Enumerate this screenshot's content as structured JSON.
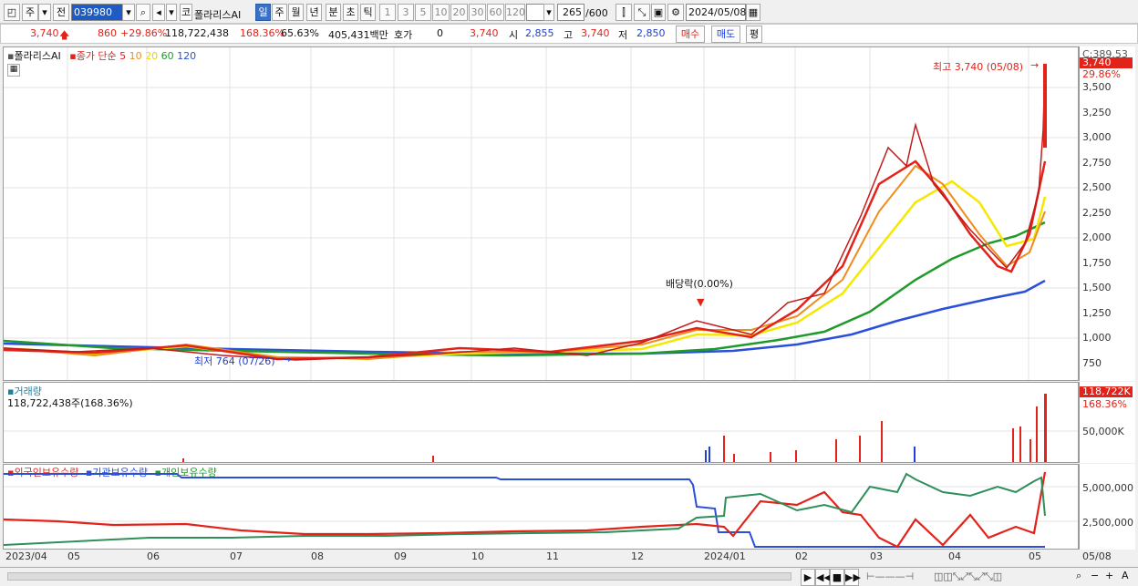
{
  "toolbar": {
    "period": "주",
    "prev": "전",
    "code": "039980",
    "market": "코",
    "name": "폴라리스AI",
    "tabs": [
      "일",
      "주",
      "월",
      "년",
      "분",
      "초",
      "틱"
    ],
    "active_tab": "일",
    "intervals": [
      "1",
      "3",
      "5",
      "10",
      "20",
      "30",
      "60",
      "120"
    ],
    "count": "265",
    "count_max": "/600",
    "date": "2024/05/08"
  },
  "quote": {
    "price": "3,740",
    "change": "860",
    "change_pct": "+29.86%",
    "volume": "118,722,438",
    "vol_ratio": "168.36%",
    "turnover_pct": "65.63%",
    "amount": "405,431백만",
    "hoga_label": "호가",
    "hoga_val": "0",
    "hoga_price": "3,740",
    "open_label": "시",
    "open": "2,855",
    "high_label": "고",
    "high": "3,740",
    "low_label": "저",
    "low": "2,850",
    "buy": "매수",
    "sell": "매도",
    "avg": "평"
  },
  "price_panel": {
    "legend_name": "폴라리스AI",
    "legend_ma": "종가 단순 5",
    "legend_ma_others": [
      "10",
      "20",
      "60",
      "120"
    ],
    "high_note": "최고 3,740 (05/08)",
    "low_note": "최저 764 (07/26)",
    "dividend": "배당락(0.00%)",
    "axis_top": "C:389.53",
    "last_price_tag": "3,740",
    "last_pct": "29.86%",
    "yticks": [
      "3,500",
      "3,250",
      "3,000",
      "2,750",
      "2,500",
      "2,250",
      "2,000",
      "1,750",
      "1,500",
      "1,250",
      "1,000",
      "750"
    ]
  },
  "volume_panel": {
    "title": "거래량",
    "subtitle": "118,722,438주(168.36%)",
    "tag": "118,722K",
    "pct": "168.36%",
    "ytick": "50,000K"
  },
  "holding_panel": {
    "legend": [
      "외국인보유수량",
      "기관보유수량",
      "개인보유수량"
    ],
    "yticks": [
      "5,000,000",
      "2,500,000"
    ]
  },
  "xaxis": [
    "2023/04",
    "05",
    "06",
    "07",
    "08",
    "09",
    "10",
    "11",
    "12",
    "2024/01",
    "02",
    "03",
    "04",
    "05",
    "05/08"
  ],
  "colors": {
    "up": "#e2231a",
    "down": "#1f3fd6",
    "ma5": "#e2231a",
    "ma10": "#f08c1a",
    "ma20": "#f5e800",
    "ma60": "#1f9a2a",
    "ma120": "#2b4fd8"
  },
  "chart_data": {
    "type": "line",
    "title": "폴라리스AI",
    "x": [
      "2023/04",
      "05",
      "06",
      "07",
      "08",
      "09",
      "10",
      "11",
      "12",
      "2024/01",
      "02",
      "03",
      "04",
      "05",
      "05/08"
    ],
    "series": [
      {
        "name": "종가",
        "values": [
          960,
          900,
          940,
          880,
          820,
          850,
          880,
          900,
          910,
          1150,
          1250,
          2800,
          2400,
          1750,
          3740
        ]
      },
      {
        "name": "60",
        "values": [
          1000,
          960,
          930,
          900,
          880,
          870,
          870,
          870,
          880,
          930,
          1100,
          1600,
          1950,
          2050,
          2150
        ]
      },
      {
        "name": "120",
        "values": [
          980,
          960,
          940,
          920,
          900,
          880,
          870,
          860,
          860,
          870,
          920,
          1050,
          1250,
          1450,
          1580
        ]
      }
    ],
    "ylim": [
      750,
      3750
    ]
  }
}
